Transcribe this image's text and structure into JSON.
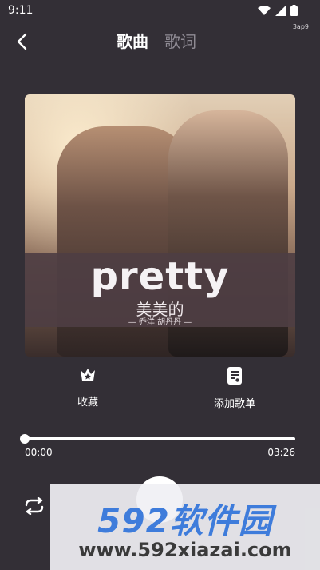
{
  "status": {
    "time": "9:11",
    "mini_label": "3ap9",
    "icons": [
      "wifi-icon",
      "signal-icon",
      "battery-icon"
    ]
  },
  "nav": {
    "back_icon": "back-arrow-icon",
    "tabs": [
      {
        "label": "歌曲",
        "active": true
      },
      {
        "label": "歌词",
        "active": false
      }
    ]
  },
  "cover": {
    "title": "pretty",
    "subtitle": "美美的",
    "artists": "— 乔洋  胡丹丹 —"
  },
  "actions": {
    "favorite": {
      "label": "收藏",
      "icon": "crown-star-icon"
    },
    "add_playlist": {
      "label": "添加歌单",
      "icon": "playlist-add-icon"
    }
  },
  "player": {
    "current_time": "00:00",
    "total_time": "03:26",
    "progress_fraction": 0.0,
    "repeat_icon": "repeat-icon",
    "play_icon": "play-button-icon"
  },
  "watermark": {
    "brand": "592软件园",
    "url": "www.592xiazai.com"
  },
  "colors": {
    "background": "#332f36",
    "accent": "#ffffff",
    "watermark_blue": "#3e7cdb"
  }
}
